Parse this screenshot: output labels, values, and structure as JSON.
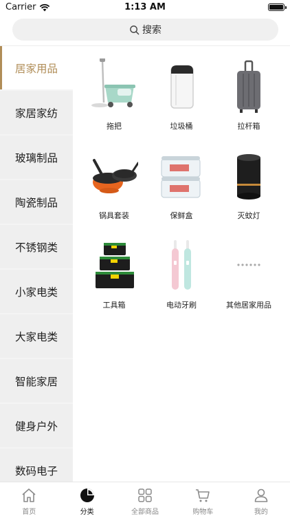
{
  "status_bar": {
    "carrier": "Carrier",
    "time": "1:13 AM"
  },
  "search": {
    "label": "搜索"
  },
  "sidebar": {
    "items": [
      {
        "label": "居家用品",
        "active": true
      },
      {
        "label": "家居家纺"
      },
      {
        "label": "玻璃制品"
      },
      {
        "label": "陶瓷制品"
      },
      {
        "label": "不锈钢类"
      },
      {
        "label": "小家电类"
      },
      {
        "label": "大家电类"
      },
      {
        "label": "智能家居"
      },
      {
        "label": "健身户外"
      },
      {
        "label": "数码电子"
      }
    ]
  },
  "products": [
    {
      "label": "拖把",
      "icon": "mop-icon"
    },
    {
      "label": "垃圾桶",
      "icon": "trash-bin-icon"
    },
    {
      "label": "拉杆箱",
      "icon": "suitcase-icon"
    },
    {
      "label": "锅具套装",
      "icon": "cookware-icon"
    },
    {
      "label": "保鲜盒",
      "icon": "food-container-icon"
    },
    {
      "label": "灭蚊灯",
      "icon": "mosquito-lamp-icon"
    },
    {
      "label": "工具箱",
      "icon": "toolbox-icon"
    },
    {
      "label": "电动牙刷",
      "icon": "toothbrush-icon"
    },
    {
      "label": "其他居家用品",
      "icon": "more-dots-icon"
    }
  ],
  "tab_bar": {
    "tabs": [
      {
        "label": "首页",
        "icon": "home-icon"
      },
      {
        "label": "分类",
        "icon": "category-icon",
        "active": true
      },
      {
        "label": "全部商品",
        "icon": "grid-icon"
      },
      {
        "label": "购物车",
        "icon": "cart-icon"
      },
      {
        "label": "我的",
        "icon": "user-icon"
      }
    ]
  },
  "colors": {
    "accent": "#b08d57",
    "sidebar_bg": "#efefef",
    "search_bg": "#f0f0f0"
  }
}
